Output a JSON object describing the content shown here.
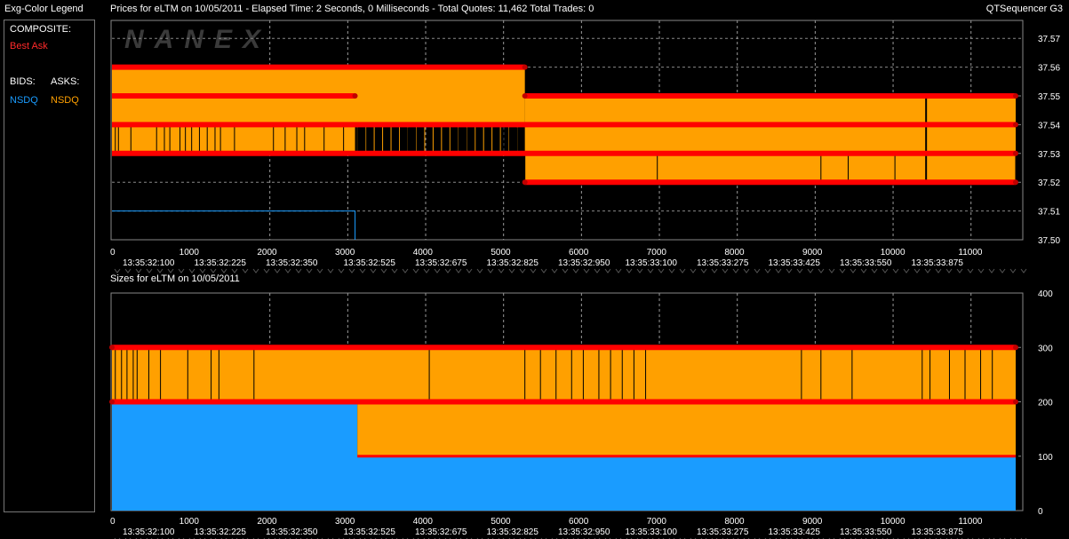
{
  "legend": {
    "title": "Exg-Color Legend",
    "composite_label": "COMPOSITE:",
    "best_ask_label": "Best Ask",
    "bids_label": "BIDS:",
    "asks_label": "ASKS:",
    "bid_exchange": "NSDQ",
    "ask_exchange": "NSDQ",
    "colors": {
      "best_ask": "#ff0000",
      "bid": "#1a9cff",
      "ask": "#ffa000"
    }
  },
  "header": {
    "title": "Prices for  eLTM  on  10/05/2011  -  Elapsed Time: 2 Seconds, 0 Milliseconds  -  Total Quotes: 11,462  Total Trades: 0",
    "app_name": "QTSequencer G3",
    "sizes_title": "Sizes for  eLTM  on  10/05/2011"
  },
  "watermark": "NANEX",
  "chart_data": [
    {
      "type": "area",
      "title": "Prices for  eLTM  on  10/05/2011",
      "x_label": "",
      "y_label": "",
      "xlim": [
        0,
        11600
      ],
      "ylim": [
        37.5,
        37.575
      ],
      "x_ticks": [
        0,
        1000,
        2000,
        3000,
        4000,
        5000,
        6000,
        7000,
        8000,
        9000,
        10000,
        11000
      ],
      "time_labels": [
        "13:35:32:100",
        "13:35:32:225",
        "13:35:32:350",
        "13:35:32:525",
        "13:35:32:675",
        "13:35:32:825",
        "13:35:32:950",
        "13:35:33:100",
        "13:35:33:275",
        "13:35:33:425",
        "13:35:33:550",
        "13:35:33:875"
      ],
      "y_ticks": [
        "37.57",
        "37.56",
        "37.55",
        "37.54",
        "37.53",
        "37.52",
        "37.51",
        "37.50"
      ],
      "series": [
        {
          "name": "Best Ask",
          "segments": [
            {
              "x": [
                0,
                5300
              ],
              "ask_hi": 37.56,
              "ask_lo": 37.54
            },
            {
              "x": [
                0,
                3120
              ],
              "ask_hi": 37.55,
              "ask_lo": 37.55
            },
            {
              "x": [
                3120,
                5300
              ],
              "ask_hi": 37.54,
              "ask_lo": 37.54
            },
            {
              "x": [
                5300,
                11600
              ],
              "ask_hi": 37.55,
              "ask_lo": 37.52
            }
          ]
        },
        {
          "name": "NSDQ Bid",
          "points": [
            [
              0,
              37.51
            ],
            [
              3120,
              37.51
            ]
          ]
        }
      ]
    },
    {
      "type": "area",
      "title": "Sizes for  eLTM  on  10/05/2011",
      "x_label": "",
      "y_label": "",
      "xlim": [
        0,
        11600
      ],
      "ylim": [
        0,
        400
      ],
      "x_ticks": [
        0,
        1000,
        2000,
        3000,
        4000,
        5000,
        6000,
        7000,
        8000,
        9000,
        10000,
        11000
      ],
      "time_labels": [
        "13:35:32:100",
        "13:35:32:225",
        "13:35:32:350",
        "13:35:32:525",
        "13:35:32:675",
        "13:35:32:825",
        "13:35:32:950",
        "13:35:33:100",
        "13:35:33:275",
        "13:35:33:425",
        "13:35:33:550",
        "13:35:33:875"
      ],
      "y_ticks": [
        "400",
        "300",
        "200",
        "100",
        "0"
      ],
      "series": [
        {
          "name": "NSDQ Bid Size",
          "steps": [
            [
              0,
              200
            ],
            [
              3150,
              100
            ],
            [
              11600,
              100
            ]
          ]
        },
        {
          "name": "NSDQ Ask Size",
          "steps": [
            [
              0,
              300
            ],
            [
              3150,
              200
            ],
            [
              11600,
              200
            ]
          ]
        },
        {
          "name": "Best Ask Size",
          "steps": [
            [
              0,
              300
            ],
            [
              11600,
              300
            ]
          ]
        }
      ]
    }
  ]
}
